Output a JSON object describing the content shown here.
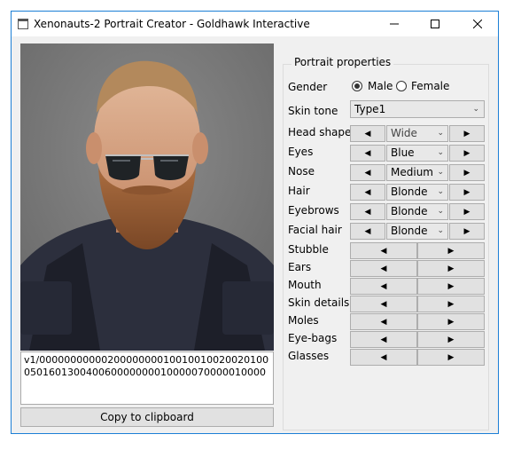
{
  "window": {
    "title": "Xenonauts-2 Portrait Creator - Goldhawk Interactive",
    "minimize_icon": "minimize-icon",
    "maximize_icon": "maximize-icon",
    "close_icon": "close-icon"
  },
  "portrait": {
    "code": "v1/0000000000020000000010010010020020100050160130040060000000010000070000010000",
    "copy_label": "Copy to clipboard"
  },
  "properties": {
    "group_label": "Portrait properties",
    "gender": {
      "label": "Gender",
      "options": [
        "Male",
        "Female"
      ],
      "selected": "Male"
    },
    "skin_tone": {
      "label": "Skin tone",
      "value": "Type1"
    },
    "select_rows": [
      {
        "label": "Head shape",
        "value": "Wide",
        "disabled": true
      },
      {
        "label": "Eyes",
        "value": "Blue"
      },
      {
        "label": "Nose",
        "value": "Medium"
      },
      {
        "label": "Hair",
        "value": "Blonde"
      },
      {
        "label": "Eyebrows",
        "value": "Blonde"
      },
      {
        "label": "Facial hair",
        "value": "Blonde"
      }
    ],
    "arrow_rows": [
      {
        "label": "Stubble"
      },
      {
        "label": "Ears"
      },
      {
        "label": "Mouth"
      },
      {
        "label": "Skin details"
      },
      {
        "label": "Moles"
      },
      {
        "label": "Eye-bags"
      },
      {
        "label": "Glasses"
      }
    ]
  },
  "glyphs": {
    "left": "◀",
    "right": "▶",
    "chevron": "⌄"
  },
  "colors": {
    "accent": "#1c7fd6",
    "background": "#f0f0f0"
  }
}
